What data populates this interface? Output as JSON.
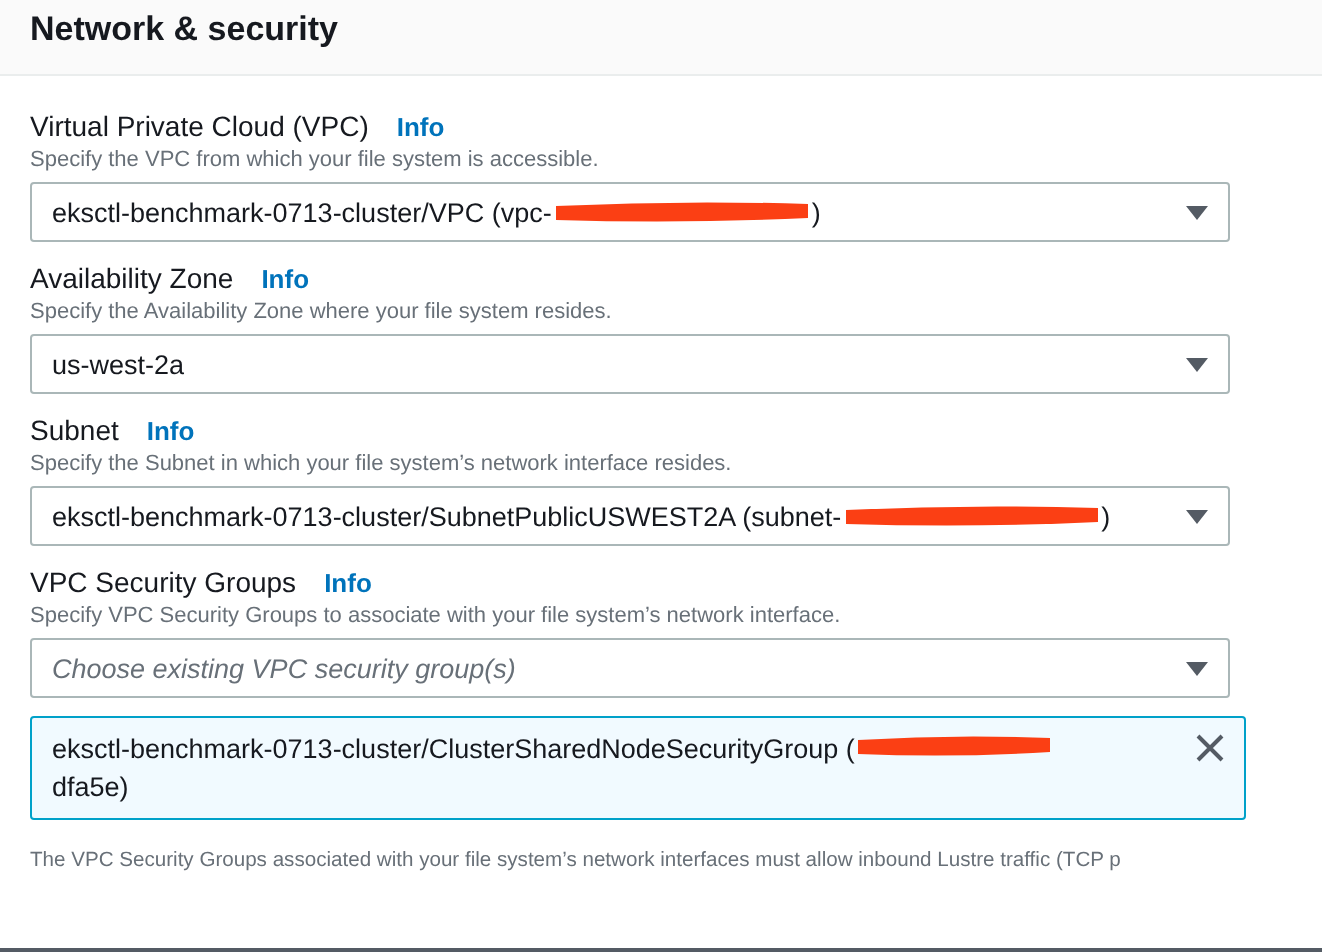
{
  "panel": {
    "title": "Network & security"
  },
  "fields": [
    {
      "label": "Virtual Private Cloud (VPC)",
      "info": "Info",
      "description": "Specify the VPC from which your file system is accessible.",
      "select": {
        "value_start": "eksctl-benchmark-0713-cluster/VPC (vpc-",
        "redacted": true,
        "value_end": ")"
      }
    },
    {
      "label": "Availability Zone",
      "info": "Info",
      "description": "Specify the Availability Zone where your file system resides.",
      "select": {
        "value_start": "us-west-2a",
        "redacted": false
      }
    },
    {
      "label": "Subnet",
      "info": "Info",
      "description": "Specify the Subnet in which your file system’s network interface resides.",
      "select": {
        "value_start": "eksctl-benchmark-0713-cluster/SubnetPublicUSWEST2A (subnet-",
        "redacted": true,
        "value_end": ")"
      }
    },
    {
      "label": "VPC Security Groups",
      "info": "Info",
      "description": "Specify VPC Security Groups to associate with your file system’s network interface.",
      "select": {
        "placeholder": "Choose existing VPC security group(s)"
      },
      "tokens": [
        {
          "value_start": "eksctl-benchmark-0713-cluster/ClusterSharedNodeSecurityGroup (",
          "redacted": true,
          "value_end": "dfa5e)"
        }
      ]
    }
  ],
  "note": "The VPC Security Groups associated with your file system’s network interfaces must allow inbound Lustre traffic (TCP p"
}
